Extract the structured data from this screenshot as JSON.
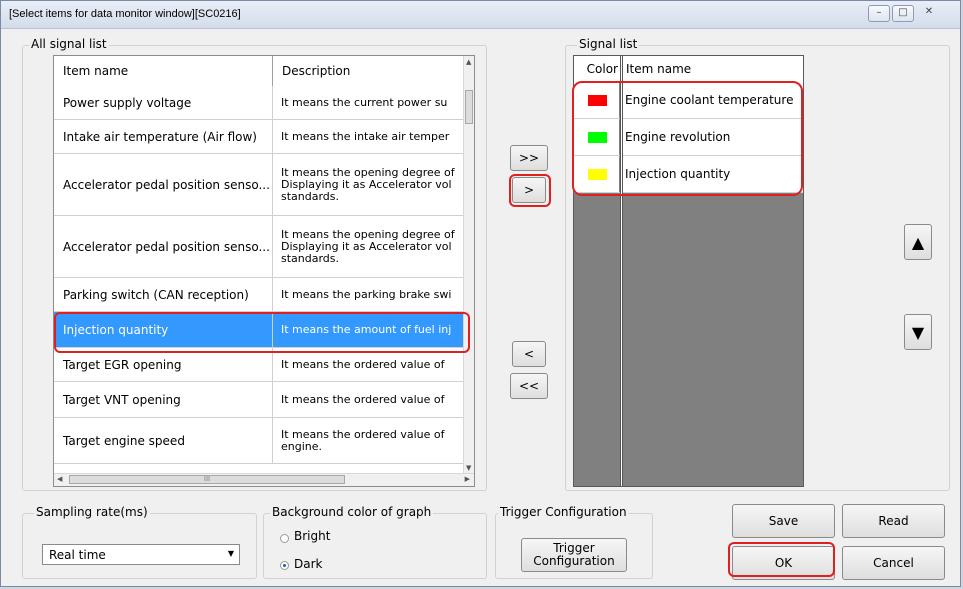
{
  "window": {
    "title": "[Select items for data monitor window][SC0216]"
  },
  "all_signal_list": {
    "label": "All signal list",
    "columns": [
      "Item name",
      "Description"
    ],
    "rows": [
      {
        "name": "Power supply voltage",
        "desc": "It means the current power su"
      },
      {
        "name": "Intake air temperature (Air flow)",
        "desc": "It means the intake air temper"
      },
      {
        "name": "Accelerator pedal position senso...",
        "desc": "It means the opening degree of Displaying it as Accelerator vol standards."
      },
      {
        "name": "Accelerator pedal position senso...",
        "desc": "It means the opening degree of Displaying it as Accelerator vol standards."
      },
      {
        "name": "Parking switch (CAN reception)",
        "desc": "It means the parking brake swi"
      },
      {
        "name": "Injection quantity",
        "desc": "It means the amount of fuel inj",
        "selected": true
      },
      {
        "name": "Target EGR opening",
        "desc": "It means the ordered value of"
      },
      {
        "name": "Target VNT opening",
        "desc": "It means the ordered value of"
      },
      {
        "name": "Target engine speed",
        "desc": "It means the ordered value of engine."
      }
    ],
    "hscroll_glyph": "III"
  },
  "transfer_buttons": {
    "add_all": ">>",
    "add": ">",
    "remove": "<",
    "remove_all": "<<"
  },
  "signal_list": {
    "label": "Signal list",
    "columns": [
      "Color",
      "Item name"
    ],
    "rows": [
      {
        "color": "#ff0000",
        "name": "Engine coolant temperature"
      },
      {
        "color": "#00ff00",
        "name": "Engine revolution"
      },
      {
        "color": "#ffff00",
        "name": "Injection quantity"
      }
    ]
  },
  "move_buttons": {
    "up": "▲",
    "down": "▼"
  },
  "sampling_rate": {
    "label": "Sampling rate(ms)",
    "value": "Real time"
  },
  "background_color": {
    "label": "Background color of graph",
    "options": [
      "Bright",
      "Dark"
    ],
    "selected": "Dark"
  },
  "trigger": {
    "label": "Trigger Configuration",
    "button_line1": "Trigger",
    "button_line2": "Configuration"
  },
  "actions": {
    "save": "Save",
    "read": "Read",
    "ok": "OK",
    "cancel": "Cancel"
  },
  "colors": {
    "selection": "#3399ff",
    "highlight": "#e02020",
    "signal_bg": "#808080"
  }
}
